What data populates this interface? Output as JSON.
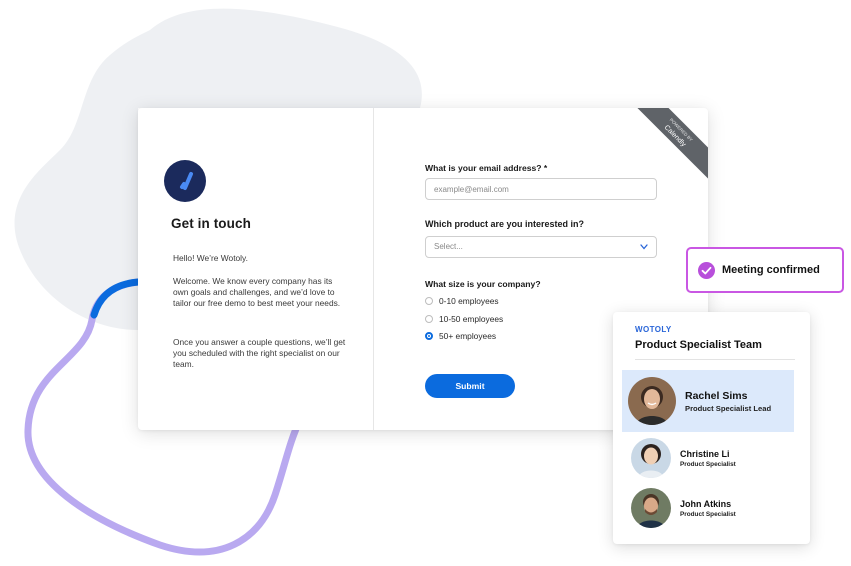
{
  "colors": {
    "accent_blue": "#0b6bde",
    "lavender_line": "#b9a9f0",
    "blob_gray": "#eef0f3",
    "meeting_purple": "#c957e3",
    "highlight_bg": "#dce9fb",
    "logo_navy": "#1b2a5c"
  },
  "left_panel": {
    "logo_icon": "wotoly-logo-icon",
    "title": "Get in touch",
    "greeting": "Hello! We’re Wotoly.",
    "welcome": "Welcome. We know every company has its own goals and challenges, and we’d love to tailor our free demo to best meet your needs.",
    "closing": "Once you answer a couple questions, we’ll get you scheduled with the right specialist on our team."
  },
  "form": {
    "email_label": "What is your email address? *",
    "email_placeholder": "example@email.com",
    "product_label": "Which product are you interested in?",
    "product_select_value": "Select...",
    "size_label": "What size is your company?",
    "size_options": [
      {
        "label": "0-10 employees",
        "checked": false
      },
      {
        "label": "10-50 employees",
        "checked": false
      },
      {
        "label": "50+ employees",
        "checked": true
      }
    ],
    "submit_label": "Submit",
    "ribbon_powered": "POWERED BY",
    "ribbon_brand": "Calendly"
  },
  "meeting": {
    "label": "Meeting confirmed",
    "icon": "check-circle-icon"
  },
  "team": {
    "brand": "WOTOLY",
    "title": "Product Specialist Team",
    "members": [
      {
        "name": "Rachel Sims",
        "role": "Product Specialist Lead",
        "highlighted": true
      },
      {
        "name": "Christine Li",
        "role": "Product Specialist",
        "highlighted": false
      },
      {
        "name": "John Atkins",
        "role": "Product Specialist",
        "highlighted": false
      }
    ]
  }
}
